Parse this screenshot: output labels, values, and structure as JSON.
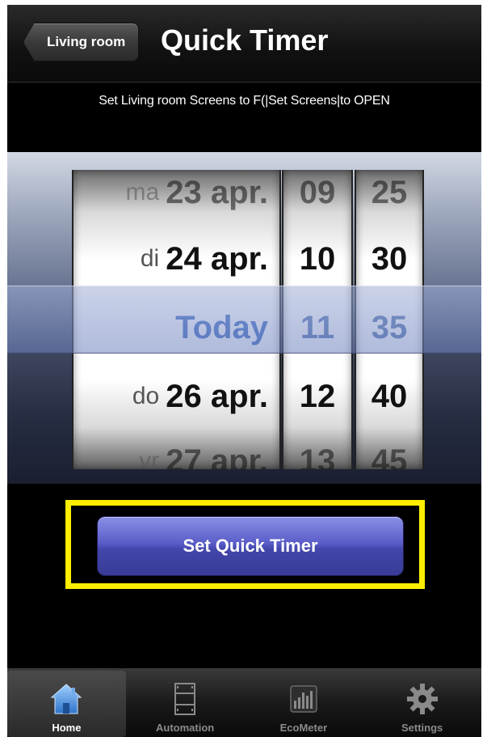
{
  "navbar": {
    "back_label": "Living room",
    "title": "Quick Timer"
  },
  "subtitle": "Set Living room Screens to F(|Set Screens|to OPEN",
  "picker": {
    "dates": [
      {
        "day": "ma",
        "date": "23 apr."
      },
      {
        "day": "di",
        "date": "24 apr."
      },
      {
        "day": "",
        "date": "Today"
      },
      {
        "day": "do",
        "date": "26 apr."
      },
      {
        "day": "vr",
        "date": "27 apr."
      }
    ],
    "hours": [
      "09",
      "10",
      "11",
      "12",
      "13"
    ],
    "minutes": [
      "25",
      "30",
      "35",
      "40",
      "45"
    ],
    "selected": {
      "date": "Today",
      "hour": "11",
      "minute": "35"
    }
  },
  "action_button_label": "Set Quick Timer",
  "tabs": [
    {
      "label": "Home",
      "icon": "home-icon",
      "active": true
    },
    {
      "label": "Automation",
      "icon": "film-strip-icon",
      "active": false
    },
    {
      "label": "EcoMeter",
      "icon": "bar-meter-icon",
      "active": false
    },
    {
      "label": "Settings",
      "icon": "gear-icon",
      "active": false
    }
  ],
  "colors": {
    "highlight_frame": "#ffee00",
    "button": "#4a4db8",
    "selected_text": "#3d6bc0"
  }
}
